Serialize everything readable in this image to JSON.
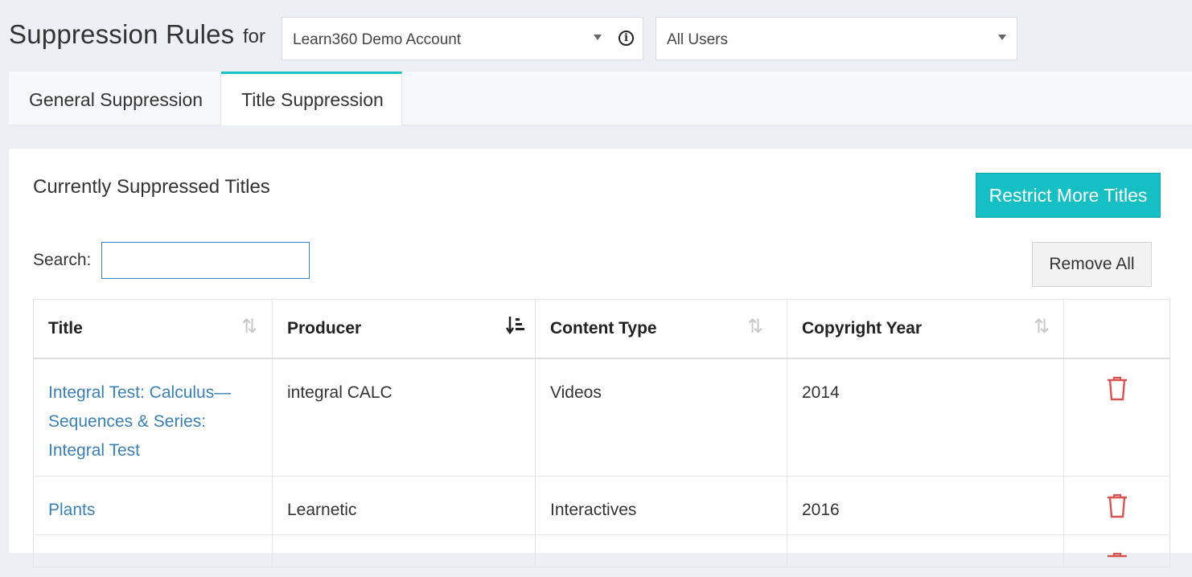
{
  "header": {
    "title": "Suppression Rules",
    "for_label": "for",
    "account_select": {
      "value": "Learn360 Demo Account"
    },
    "info_icon": "info-icon",
    "users_select": {
      "value": "All Users"
    }
  },
  "tabs": [
    {
      "label": "General Suppression",
      "active": false
    },
    {
      "label": "Title Suppression",
      "active": true
    }
  ],
  "panel": {
    "section_title": "Currently Suppressed Titles",
    "restrict_button": "Restrict More Titles",
    "search_label": "Search:",
    "search_value": "",
    "remove_all_button": "Remove All"
  },
  "table": {
    "columns": [
      {
        "label": "Title",
        "sort_icon": "sort-icon",
        "active": false
      },
      {
        "label": "Producer",
        "sort_icon": "sort-descending-icon",
        "active": true
      },
      {
        "label": "Content Type",
        "sort_icon": "sort-icon",
        "active": false
      },
      {
        "label": "Copyright Year",
        "sort_icon": "sort-icon",
        "active": false
      }
    ],
    "rows": [
      {
        "title": "Integral Test: Calculus—Sequences & Series: Integral Test",
        "producer": "integral CALC",
        "content_type": "Videos",
        "year": "2014"
      },
      {
        "title": "Plants",
        "producer": "Learnetic",
        "content_type": "Interactives",
        "year": "2016"
      }
    ]
  },
  "colors": {
    "accent": "#16bfc3",
    "link": "#3b7fb6",
    "delete": "#d9534f"
  }
}
